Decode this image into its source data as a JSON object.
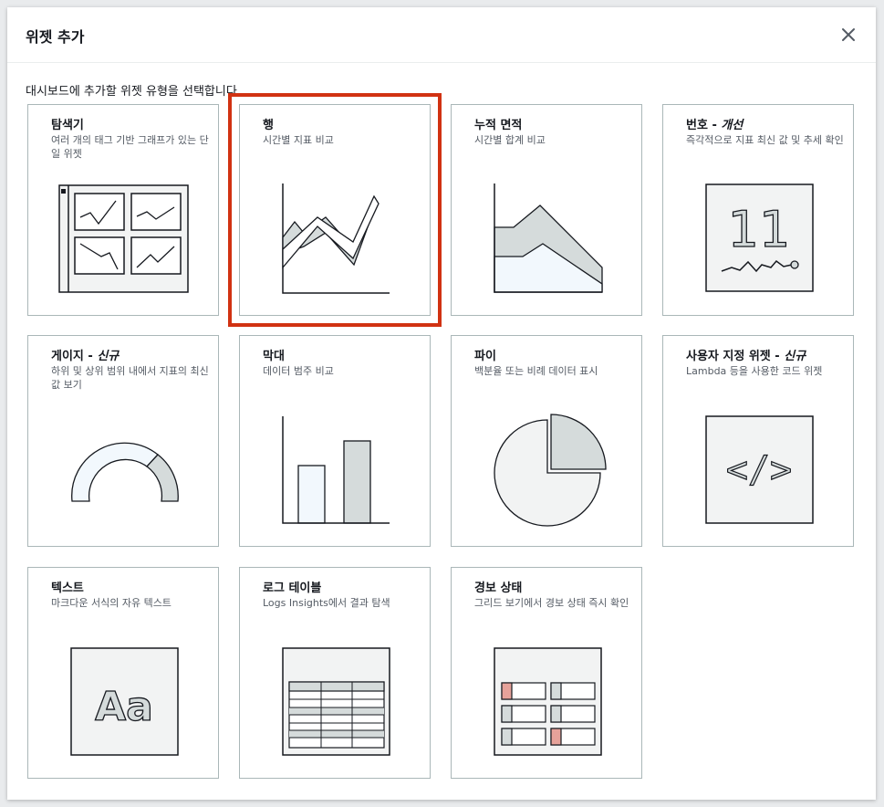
{
  "modal": {
    "title": "위젯 추가",
    "description": "대시보드에 추가할 위젯 유형을 선택합니다."
  },
  "widgets": [
    {
      "id": "explorer",
      "title": "탐색기",
      "tag": "",
      "desc": "여러 개의 태그 기반 그래프가 있는 단일 위젯",
      "icon": "explorer-icon"
    },
    {
      "id": "line",
      "title": "행",
      "tag": "",
      "desc": "시간별 지표 비교",
      "icon": "line-chart-icon",
      "selected": true
    },
    {
      "id": "stacked-area",
      "title": "누적 면적",
      "tag": "",
      "desc": "시간별 합계 비교",
      "icon": "stacked-area-icon"
    },
    {
      "id": "number",
      "title": "번호 - ",
      "tag": "개선",
      "desc": "즉각적으로 지표 최신 값 및 추세 확인",
      "icon": "number-icon"
    },
    {
      "id": "gauge",
      "title": "게이지 - ",
      "tag": "신규",
      "desc": "하위 및 상위 범위 내에서 지표의 최신 값 보기",
      "icon": "gauge-icon"
    },
    {
      "id": "bar",
      "title": "막대",
      "tag": "",
      "desc": "데이터 범주 비교",
      "icon": "bar-chart-icon"
    },
    {
      "id": "pie",
      "title": "파이",
      "tag": "",
      "desc": "백분율 또는 비례 데이터 표시",
      "icon": "pie-chart-icon"
    },
    {
      "id": "custom",
      "title": "사용자 지정 위젯 - ",
      "tag": "신규",
      "desc": "Lambda 등을 사용한 코드 위젯",
      "icon": "code-icon"
    },
    {
      "id": "text",
      "title": "텍스트",
      "tag": "",
      "desc": "마크다운 서식의 자유 텍스트",
      "icon": "text-icon"
    },
    {
      "id": "logs-table",
      "title": "로그 테이블",
      "tag": "",
      "desc": "Logs Insights에서 결과 탐색",
      "icon": "table-icon"
    },
    {
      "id": "alarm-status",
      "title": "경보 상태",
      "tag": "",
      "desc": "그리드 보기에서 경보 상태 즉시 확인",
      "icon": "alarm-status-icon"
    }
  ],
  "illustrations": {
    "number_value": "11",
    "text_sample": "Aa",
    "code_sample": "</>"
  },
  "colors": {
    "selected_outline": "#d13212",
    "card_border": "#aab7b8",
    "illus_stroke": "#16191f",
    "illus_fill_gray": "#d5dbdb",
    "illus_fill_blue": "#f2f8fd",
    "alarm_red": "#e6a29a"
  }
}
